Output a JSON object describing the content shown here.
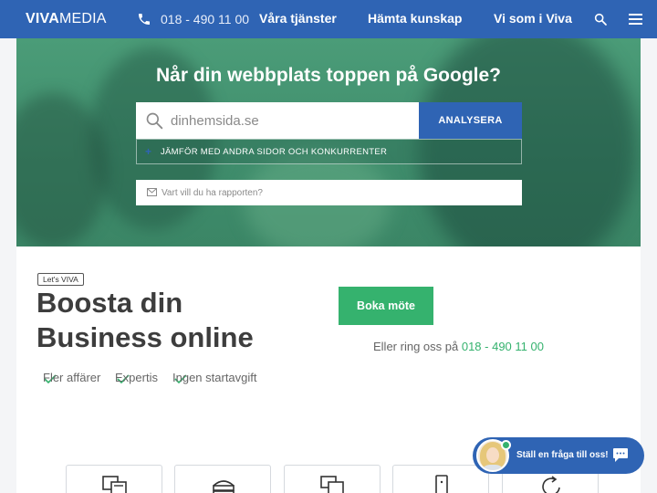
{
  "nav": {
    "logo_bold": "VIVA",
    "logo_light": "MEDIA",
    "phone": "018 - 490 11 00",
    "links": [
      "Våra tjänster",
      "Hämta kunskap",
      "Vi som i Viva"
    ]
  },
  "hero": {
    "title": "Når din webbplats toppen på Google?",
    "url_placeholder": "dinhemsida.se",
    "analyse_label": "ANALYSERA",
    "compare_label": "JÄMFÖR MED ANDRA SIDOR OCH KONKURRENTER",
    "email_placeholder": "Vart vill du ha rapporten?"
  },
  "content": {
    "tag": "Let's VIVA",
    "headline_line1": "Boosta din",
    "headline_line2": "Business online",
    "features": [
      "Fler affärer",
      "Expertis",
      "Ingen startavgift"
    ],
    "book_label": "Boka möte",
    "call_prefix": "Eller ring oss på",
    "call_number": "018 - 490 11 00"
  },
  "cards": [
    "web-design-icon",
    "hosting-icon",
    "devices-icon",
    "mobile-icon",
    "refresh-icon"
  ],
  "chat": {
    "label": "Ställ en fråga till oss!"
  },
  "colors": {
    "primary_blue": "#2f64b4",
    "accent_green": "#35b26e",
    "hero_green": "#4b9c78",
    "text_dark": "#3d3d3d"
  }
}
